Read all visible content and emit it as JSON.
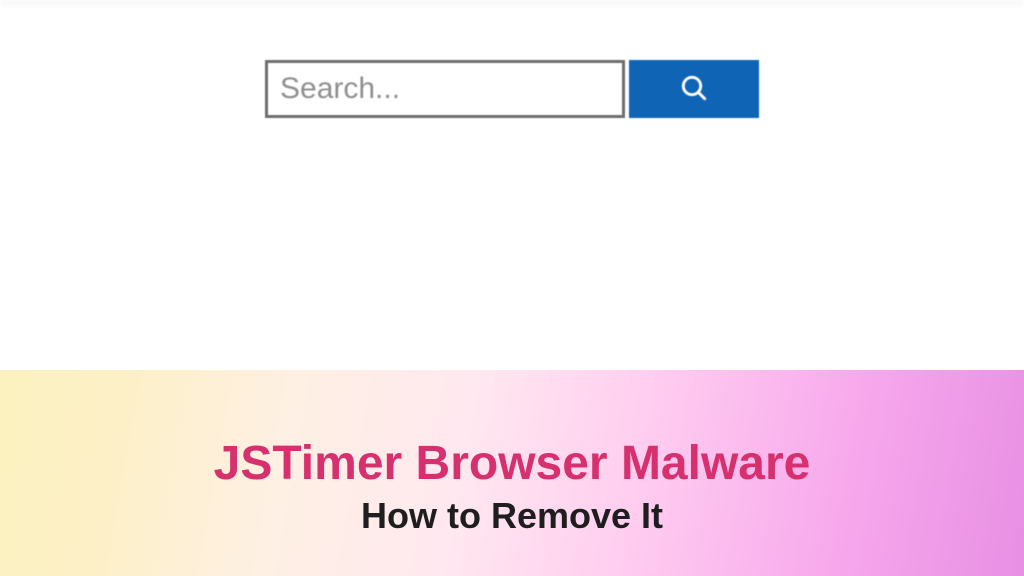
{
  "search": {
    "placeholder": "Search...",
    "value": "",
    "button_aria": "Search"
  },
  "banner": {
    "title": "JSTimer Browser Malware",
    "subtitle": "How to Remove It"
  },
  "colors": {
    "button_bg": "#0f64b5",
    "title_color": "#d6306e"
  }
}
